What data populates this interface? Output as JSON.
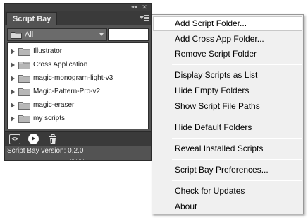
{
  "panel": {
    "collapse_glyph": "◂◂",
    "close_glyph": "✕",
    "tab_title": "Script Bay",
    "folder_select": {
      "value": "All"
    },
    "tree_items": [
      {
        "label": "Illustrator"
      },
      {
        "label": "Cross Application"
      },
      {
        "label": "magic-monogram-light-v3"
      },
      {
        "label": "Magic-Pattern-Pro-v2"
      },
      {
        "label": "magic-eraser"
      },
      {
        "label": "my scripts"
      }
    ],
    "toolbar": {
      "code_glyph": "<>"
    },
    "status_text": "Script Bay version: 0.2.0"
  },
  "menu": {
    "items": [
      {
        "label": "Add Script Folder..."
      },
      {
        "label": "Add Cross App Folder..."
      },
      {
        "label": "Remove Script Folder"
      },
      {
        "label": "Display Scripts as List"
      },
      {
        "label": "Hide Empty Folders"
      },
      {
        "label": "Show Script File Paths"
      },
      {
        "label": "Hide Default Folders"
      },
      {
        "label": "Reveal Installed Scripts"
      },
      {
        "label": "Script Bay Preferences..."
      },
      {
        "label": "Check for Updates"
      },
      {
        "label": "About"
      }
    ]
  },
  "colors": {
    "panel_bg": "#535353",
    "panel_dark": "#3a3a3a",
    "menu_bg": "#f0f0f0",
    "tree_text": "#1a1a1a"
  }
}
